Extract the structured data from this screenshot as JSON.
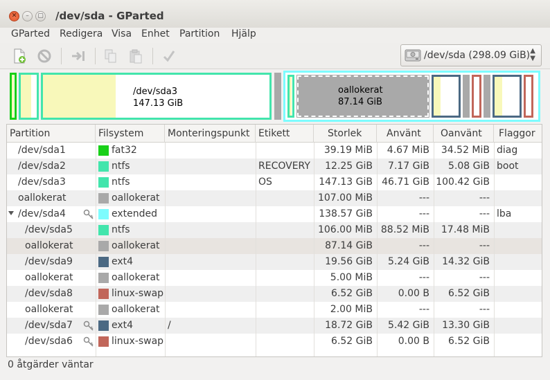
{
  "window": {
    "title": "/dev/sda - GParted",
    "close_glyph": "✕",
    "min_glyph": "–",
    "max_glyph": "▢"
  },
  "menu": [
    "GParted",
    "Redigera",
    "Visa",
    "Enhet",
    "Partition",
    "Hjälp"
  ],
  "toolbar": {
    "device_label": "/dev/sda  (298.09 GiB)",
    "device_icon": "harddisk-icon",
    "icons": [
      "new-partition-icon",
      "delete-partition-icon",
      "resize-move-icon",
      "copy-icon",
      "paste-icon",
      "apply-icon"
    ]
  },
  "diskmap": {
    "sda3_name": "/dev/sda3",
    "sda3_size": "147.13 GiB",
    "unalloc_name": "oallokerat",
    "unalloc_size": "87.14 GiB"
  },
  "colors": {
    "fat32": "#18d018",
    "ntfs": "#42e5ac",
    "extended": "#7dfcfe",
    "unallocated": "#a9a9a9",
    "ext4": "#4b6983",
    "linux_swap": "#c1665a",
    "used_fill": "#f8f8ba"
  },
  "table": {
    "headers": [
      "Partition",
      "Filsystem",
      "Monteringspunkt",
      "Etikett",
      "Storlek",
      "Använt",
      "Oanvänt",
      "Flaggor"
    ],
    "rows": [
      {
        "partition": "/dev/sda1",
        "fs": "fat32",
        "fs_color": "#18d018",
        "mount": "",
        "label": "",
        "size": "39.19 MiB",
        "used": "4.67 MiB",
        "unused": "34.52 MiB",
        "flags": "diag",
        "key": false,
        "indent": false
      },
      {
        "partition": "/dev/sda2",
        "fs": "ntfs",
        "fs_color": "#42e5ac",
        "mount": "",
        "label": "RECOVERY",
        "size": "12.25 GiB",
        "used": "7.17 GiB",
        "unused": "5.08 GiB",
        "flags": "boot",
        "key": false,
        "indent": false
      },
      {
        "partition": "/dev/sda3",
        "fs": "ntfs",
        "fs_color": "#42e5ac",
        "mount": "",
        "label": "OS",
        "size": "147.13 GiB",
        "used": "46.71 GiB",
        "unused": "100.42 GiB",
        "flags": "",
        "key": false,
        "indent": false
      },
      {
        "partition": "oallokerat",
        "fs": "oallokerat",
        "fs_color": "#a9a9a9",
        "mount": "",
        "label": "",
        "size": "107.00 MiB",
        "used": "---",
        "unused": "---",
        "flags": "",
        "key": false,
        "indent": false
      },
      {
        "partition": "/dev/sda4",
        "fs": "extended",
        "fs_color": "#7dfcfe",
        "mount": "",
        "label": "",
        "size": "138.57 GiB",
        "used": "---",
        "unused": "---",
        "flags": "lba",
        "key": true,
        "indent": false,
        "expander": true
      },
      {
        "partition": "/dev/sda5",
        "fs": "ntfs",
        "fs_color": "#42e5ac",
        "mount": "",
        "label": "",
        "size": "106.00 MiB",
        "used": "88.52 MiB",
        "unused": "17.48 MiB",
        "flags": "",
        "key": false,
        "indent": true
      },
      {
        "partition": "oallokerat",
        "fs": "oallokerat",
        "fs_color": "#a9a9a9",
        "mount": "",
        "label": "",
        "size": "87.14 GiB",
        "used": "---",
        "unused": "---",
        "flags": "",
        "key": false,
        "indent": true
      },
      {
        "partition": "/dev/sda9",
        "fs": "ext4",
        "fs_color": "#4b6983",
        "mount": "",
        "label": "",
        "size": "19.56 GiB",
        "used": "5.24 GiB",
        "unused": "14.32 GiB",
        "flags": "",
        "key": false,
        "indent": true
      },
      {
        "partition": "oallokerat",
        "fs": "oallokerat",
        "fs_color": "#a9a9a9",
        "mount": "",
        "label": "",
        "size": "5.00 MiB",
        "used": "---",
        "unused": "---",
        "flags": "",
        "key": false,
        "indent": true
      },
      {
        "partition": "/dev/sda8",
        "fs": "linux-swap",
        "fs_color": "#c1665a",
        "mount": "",
        "label": "",
        "size": "6.52 GiB",
        "used": "0.00 B",
        "unused": "6.52 GiB",
        "flags": "",
        "key": false,
        "indent": true
      },
      {
        "partition": "oallokerat",
        "fs": "oallokerat",
        "fs_color": "#a9a9a9",
        "mount": "",
        "label": "",
        "size": "2.00 MiB",
        "used": "---",
        "unused": "---",
        "flags": "",
        "key": false,
        "indent": true
      },
      {
        "partition": "/dev/sda7",
        "fs": "ext4",
        "fs_color": "#4b6983",
        "mount": "/",
        "label": "",
        "size": "18.72 GiB",
        "used": "5.42 GiB",
        "unused": "13.30 GiB",
        "flags": "",
        "key": true,
        "indent": true
      },
      {
        "partition": "/dev/sda6",
        "fs": "linux-swap",
        "fs_color": "#c1665a",
        "mount": "",
        "label": "",
        "size": "6.52 GiB",
        "used": "0.00 B",
        "unused": "6.52 GiB",
        "flags": "",
        "key": true,
        "indent": true
      }
    ]
  },
  "status": "0 åtgärder väntar"
}
